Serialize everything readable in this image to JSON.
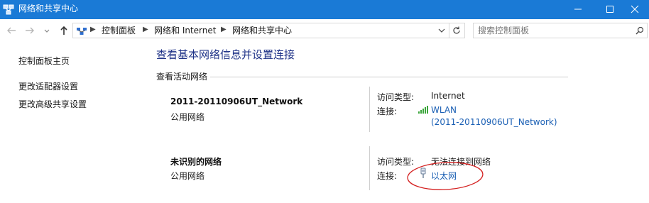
{
  "window": {
    "title": "网络和共享中心"
  },
  "breadcrumb": [
    "控制面板",
    "网络和 Internet",
    "网络和共享中心"
  ],
  "search": {
    "placeholder": "搜索控制面板"
  },
  "sidebar": {
    "items": [
      "控制面板主页",
      "更改适配器设置",
      "更改高级共享设置"
    ]
  },
  "main": {
    "title": "查看基本网络信息并设置连接",
    "section": "查看活动网络",
    "networks": [
      {
        "name": "2011-20110906UT_Network",
        "type": "公用网络",
        "access_label": "访问类型:",
        "access_value": "Internet",
        "conn_label": "连接:",
        "conn_line1": "WLAN",
        "conn_line2": "(2011-20110906UT_Network)",
        "icon": "wifi-signal-icon"
      },
      {
        "name": "未识别的网络",
        "type": "公用网络",
        "access_label": "访问类型:",
        "access_value": "无法连接到网络",
        "conn_label": "连接:",
        "conn_line1": "以太网",
        "icon": "ethernet-icon"
      }
    ]
  },
  "annotation_color": "#d42020"
}
